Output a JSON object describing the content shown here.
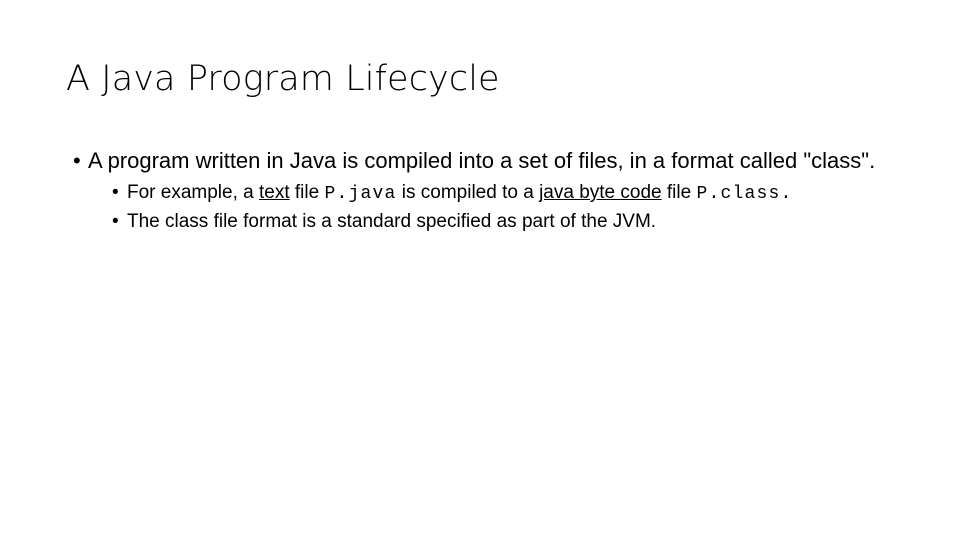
{
  "slide": {
    "title": "A Java Program Lifecycle",
    "background_color": "#ffffff",
    "text_color": "#000000",
    "bullet_glyph": "•",
    "content": {
      "bullet1": {
        "text_before": "A program written in Java is compiled into a set of files, in a format called ",
        "quoted_term": "\"class\"",
        "text_after": "."
      },
      "bullet2": {
        "part1": "For example, a ",
        "underline1": "text",
        "part2": " file ",
        "code1": "P.java",
        "part3": " is compiled to a ",
        "underline2": "java byte code",
        "part4": " file ",
        "code2": "P.class."
      },
      "bullet3": {
        "text": "The class file format is a standard specified as part of the JVM."
      }
    }
  }
}
